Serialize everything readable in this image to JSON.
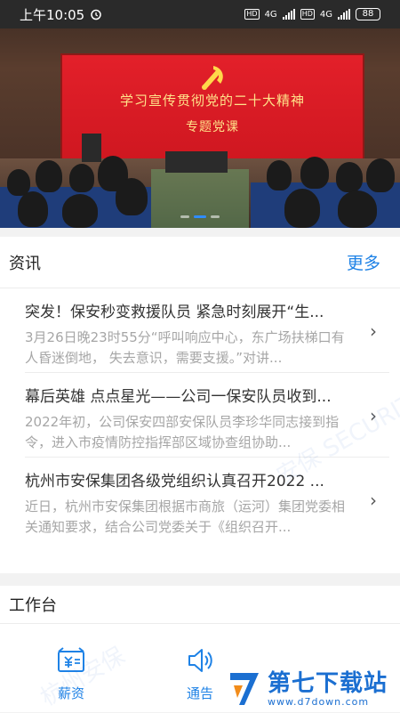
{
  "status_bar": {
    "time": "上午10:05",
    "network_1": "4G",
    "network_2": "4G",
    "battery": "88"
  },
  "banner": {
    "headline": "学习宣传贯彻党的二十大精神",
    "subheadline": "专题党课"
  },
  "news": {
    "section_title": "资讯",
    "more_label": "更多",
    "items": [
      {
        "title": "突发！保安秒变救援队员 紧急时刻展开“生...",
        "summary": "3月26日晚23时55分“呼叫响应中心，东广场扶梯口有人昏迷倒地， 失去意识，需要支援。”对讲..."
      },
      {
        "title": "幕后英雄 点点星光——公司一保安队员收到...",
        "summary": "2022年初，公司保安四部安保队员李珍华同志接到指令，进入市疫情防控指挥部区域协查组协助..."
      },
      {
        "title": "杭州市安保集团各级党组织认真召开2022 ...",
        "summary": "近日，杭州市安保集团根据市商旅（运河）集团党委相关通知要求，结合公司党委关于《组织召开..."
      }
    ]
  },
  "workbench": {
    "section_title": "工作台",
    "items": [
      {
        "label": "薪资",
        "icon": "salary-icon"
      },
      {
        "label": "通告",
        "icon": "speaker-icon"
      }
    ]
  },
  "watermark": {
    "brand": "第七下载站",
    "url": "www.d7down.com"
  },
  "colors": {
    "accent": "#1e82e6",
    "banner_red": "#e3202a"
  }
}
